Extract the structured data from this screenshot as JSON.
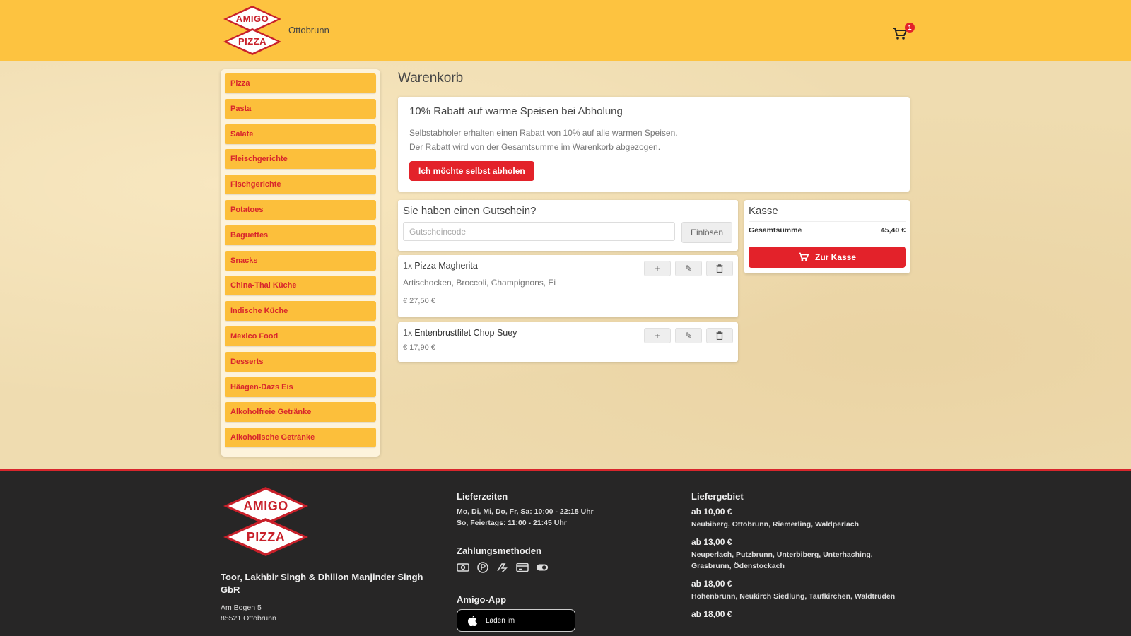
{
  "header": {
    "logo_top": "AMIGO",
    "logo_bottom": "PIZZA",
    "city": "Ottobrunn",
    "cart_count": "1",
    "cart_icon": "shopping-cart-icon"
  },
  "sidebar": {
    "categories": [
      "Pizza",
      "Pasta",
      "Salate",
      "Fleischgerichte",
      "Fischgerichte",
      "Potatoes",
      "Baguettes",
      "Snacks",
      "China-Thai Küche",
      "Indische Küche",
      "Mexico Food",
      "Desserts",
      "Häagen-Dazs Eis",
      "Alkoholfreie Getränke",
      "Alkoholische Getränke"
    ]
  },
  "main": {
    "title": "Warenkorb",
    "promo": {
      "title": "10% Rabatt auf warme Speisen bei Abholung",
      "line1": "Selbstabholer erhalten einen Rabatt von 10% auf alle warmen Speisen.",
      "line2": "Der Rabatt wird von der Gesamtsumme im Warenkorb abgezogen.",
      "button": "Ich möchte selbst abholen"
    },
    "voucher": {
      "title": "Sie haben einen Gutschein?",
      "placeholder": "Gutscheincode",
      "button": "Einlösen"
    },
    "items": [
      {
        "qty": "1x",
        "name": "Pizza Magherita",
        "extras": "Artischocken, Broccoli, Champignons, Ei",
        "price": "€ 27,50 €"
      },
      {
        "qty": "1x",
        "name": "Entenbrustfilet Chop Suey",
        "extras": "",
        "price": "€ 17,90 €"
      }
    ],
    "checkout": {
      "title": "Kasse",
      "sum_label": "Gesamtsumme",
      "sum_value": "45,40 €",
      "button": "Zur Kasse"
    }
  },
  "footer": {
    "logo_top": "AMIGO",
    "logo_bottom": "PIZZA",
    "owner": "Toor, Lakhbir Singh & Dhillon Manjinder Singh GbR",
    "street": "Am Bogen 5",
    "zip_city": "85521 Ottobrunn",
    "hours_title": "Lieferzeiten",
    "hours_1": "Mo, Di, Mi, Do, Fr, Sa: 10:00 - 22:15 Uhr",
    "hours_2": "So, Feiertags: 11:00 - 21:45 Uhr",
    "payment_title": "Zahlungsmethoden",
    "payment_icons": [
      "cash-icon",
      "paypal-icon",
      "sofort-icon",
      "card-icon",
      "ec-icon"
    ],
    "app_title": "Amigo-App",
    "app_button": "Laden im",
    "zones_title": "Liefergebiet",
    "zones": [
      {
        "price": "ab 10,00 €",
        "towns": "Neubiberg, Ottobrunn, Riemerling, Waldperlach"
      },
      {
        "price": "ab 13,00 €",
        "towns": "Neuperlach, Putzbrunn, Unterbiberg, Unterhaching, Grasbrunn, Ödenstockach"
      },
      {
        "price": "ab 18,00 €",
        "towns": "Hohenbrunn, Neukirch Siedlung, Taufkirchen, Waldtruden"
      },
      {
        "price": "ab 18,00 €",
        "towns": ""
      }
    ]
  }
}
